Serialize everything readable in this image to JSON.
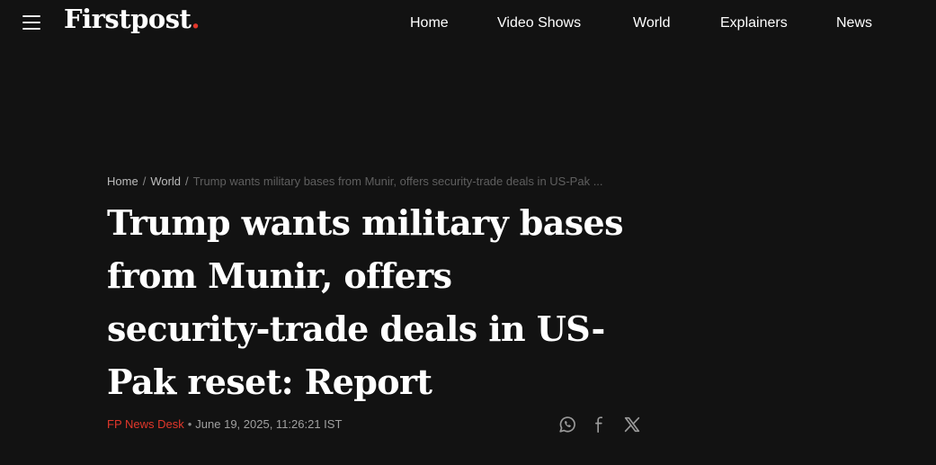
{
  "header": {
    "logo_text": "Firstpost",
    "logo_dot": ".",
    "nav": [
      {
        "label": "Home"
      },
      {
        "label": "Video Shows"
      },
      {
        "label": "World"
      },
      {
        "label": "Explainers"
      },
      {
        "label": "News"
      }
    ],
    "menu_icon": "hamburger-icon"
  },
  "breadcrumb": {
    "items": [
      "Home",
      "World"
    ],
    "separator": "/",
    "current": "Trump wants military bases from Munir, offers security-trade deals in US-Pak ..."
  },
  "article": {
    "title": "Trump wants military bases from Munir, offers security-trade deals in US-Pak reset: Report",
    "author": "FP News Desk",
    "bullet": "•",
    "date": "June 19, 2025, 11:26:21 IST"
  },
  "share": [
    {
      "icon": "whatsapp-icon"
    },
    {
      "icon": "facebook-icon"
    },
    {
      "icon": "x-icon"
    }
  ],
  "colors": {
    "background": "#121212",
    "accent": "#e2372b",
    "text": "#ffffff"
  }
}
